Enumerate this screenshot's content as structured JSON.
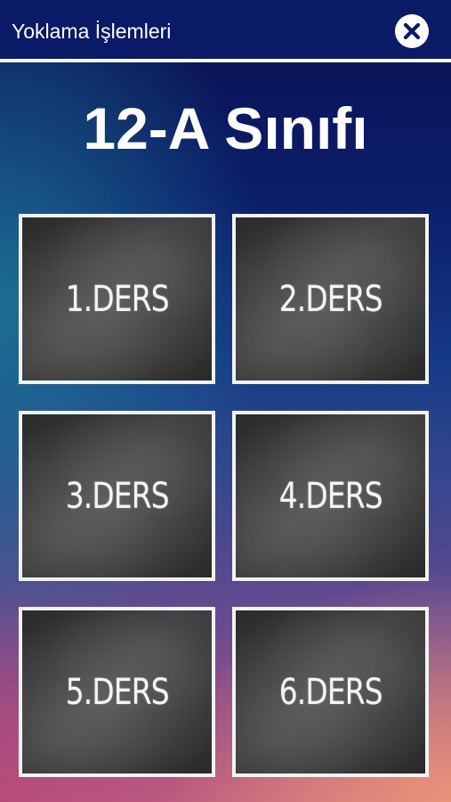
{
  "header": {
    "title": "Yoklama İşlemleri",
    "close_icon": "close-icon"
  },
  "page": {
    "title": "12-A Sınıfı"
  },
  "lessons": [
    {
      "label": "1.DERS"
    },
    {
      "label": "2.DERS"
    },
    {
      "label": "3.DERS"
    },
    {
      "label": "4.DERS"
    },
    {
      "label": "5.DERS"
    },
    {
      "label": "6.DERS"
    }
  ],
  "colors": {
    "header_background": "#0b1a66",
    "tile_border": "#f2f2f2",
    "close_icon_color": "#0b1a66"
  }
}
